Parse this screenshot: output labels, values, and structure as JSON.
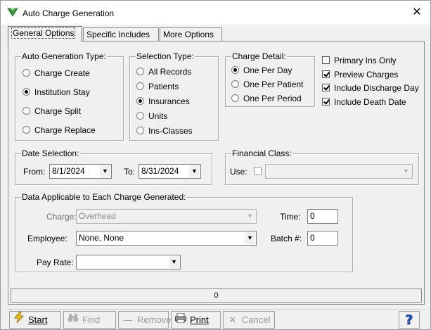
{
  "window": {
    "title": "Auto Charge Generation",
    "close_glyph": "✕"
  },
  "tabs": [
    "General Options",
    "Specific Includes",
    "More Options"
  ],
  "auto_generation": {
    "legend": "Auto Generation Type:",
    "options": [
      {
        "label": "Charge Create",
        "selected": false
      },
      {
        "label": "Institution Stay",
        "selected": true
      },
      {
        "label": "Charge Split",
        "selected": false
      },
      {
        "label": "Charge Replace",
        "selected": false
      }
    ]
  },
  "selection_type": {
    "legend": "Selection Type:",
    "options": [
      {
        "label": "All Records",
        "selected": false
      },
      {
        "label": "Patients",
        "selected": false
      },
      {
        "label": "Insurances",
        "selected": true
      },
      {
        "label": "Units",
        "selected": false
      },
      {
        "label": "Ins-Classes",
        "selected": false
      }
    ]
  },
  "charge_detail": {
    "legend": "Charge Detail:",
    "options": [
      {
        "label": "One Per Day",
        "selected": true
      },
      {
        "label": "One Per Patient",
        "selected": false
      },
      {
        "label": "One Per Period",
        "selected": false
      }
    ]
  },
  "checkboxes": [
    {
      "label": "Primary Ins Only",
      "checked": false
    },
    {
      "label": "Preview Charges",
      "checked": true
    },
    {
      "label": "Include Discharge Day",
      "checked": true
    },
    {
      "label": "Include Death Date",
      "checked": true
    }
  ],
  "date_selection": {
    "legend": "Date Selection:",
    "from_label": "From:",
    "from_value": "8/1/2024",
    "to_label": "To:",
    "to_value": "8/31/2024"
  },
  "financial_class": {
    "legend": "Financial Class:",
    "use_label": "Use:",
    "use_checked": false,
    "value": ""
  },
  "charge_data": {
    "legend": "Data Applicable to Each Charge Generated:",
    "charge_label": "Charge:",
    "charge_value": "Overhead",
    "employee_label": "Employee:",
    "employee_value": "None, None",
    "payrate_label": "Pay Rate:",
    "payrate_value": "",
    "time_label": "Time:",
    "time_value": "0",
    "batch_label": "Batch #:",
    "batch_value": "0"
  },
  "progress": {
    "value_text": "0"
  },
  "toolbar": {
    "start": "Start",
    "find": "Find",
    "remove": "Remove",
    "print": "Print",
    "cancel": "Cancel",
    "help": "?"
  },
  "icons": {
    "app": "green-arrow-icon",
    "start": "lightning-icon",
    "find": "binoculars-icon",
    "remove": "minus-icon",
    "print": "printer-icon",
    "cancel": "x-icon",
    "help": "question-icon"
  },
  "colors": {
    "accent": "#2e8b2e",
    "help_blue": "#1f4fbf",
    "window_bg": "#f0f0f0"
  }
}
